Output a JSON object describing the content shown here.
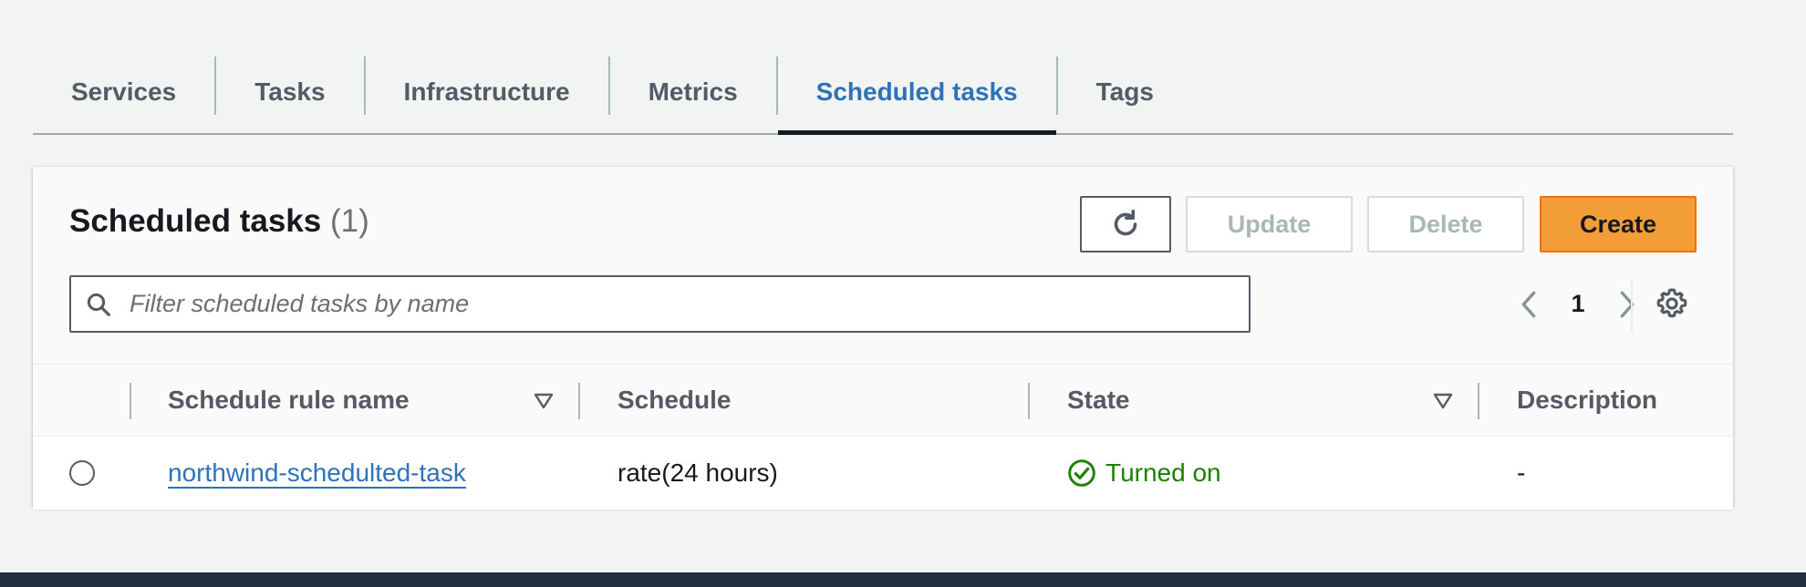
{
  "tabs": [
    {
      "label": "Services"
    },
    {
      "label": "Tasks"
    },
    {
      "label": "Infrastructure"
    },
    {
      "label": "Metrics"
    },
    {
      "label": "Scheduled tasks",
      "active": true
    },
    {
      "label": "Tags"
    }
  ],
  "panel": {
    "title": "Scheduled tasks",
    "count": "(1)"
  },
  "buttons": {
    "refresh_icon": "refresh-icon",
    "update": "Update",
    "delete": "Delete",
    "create": "Create"
  },
  "search": {
    "placeholder": "Filter scheduled tasks by name",
    "value": ""
  },
  "pagination": {
    "current_page": "1"
  },
  "table": {
    "columns": [
      "Schedule rule name",
      "Schedule",
      "State",
      "Description"
    ],
    "rows": [
      {
        "name": "northwind-schedulted-task",
        "schedule": "rate(24 hours)",
        "state": "Turned on",
        "description": "-"
      }
    ]
  },
  "colors": {
    "accent": "#2e73b8",
    "primary_button": "#f29d38",
    "success": "#1d8102"
  }
}
